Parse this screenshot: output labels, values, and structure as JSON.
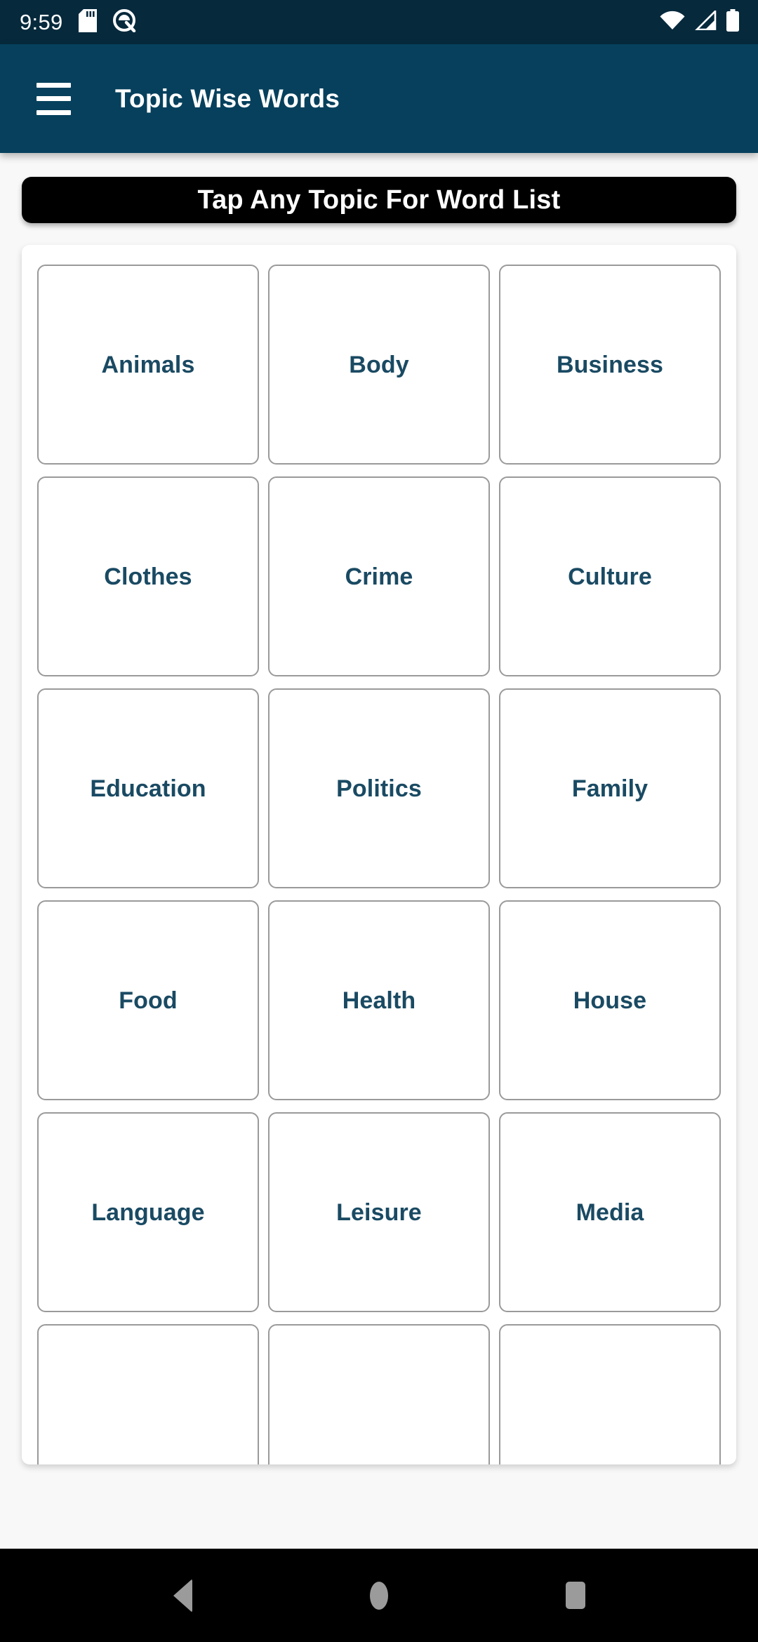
{
  "status_bar": {
    "clock": "9:59",
    "icons_left": [
      "sd-card-icon",
      "android-q-icon"
    ],
    "icons_right": [
      "wifi-icon",
      "cellular-signal-icon",
      "battery-icon"
    ],
    "background_color": "#06293c"
  },
  "app_bar": {
    "menu_icon": "hamburger-menu-icon",
    "title": "Topic Wise Words",
    "background_color": "#06405c",
    "text_color": "#ffffff"
  },
  "banner": {
    "text": "Tap Any Topic For Word List",
    "background_color": "#000000",
    "text_color": "#ffffff"
  },
  "topic_grid": {
    "columns": 3,
    "accent_text_color": "#1a4a63",
    "border_color": "#9a9a9a",
    "topics": [
      {
        "label": "Animals"
      },
      {
        "label": "Body"
      },
      {
        "label": "Business"
      },
      {
        "label": "Clothes"
      },
      {
        "label": "Crime"
      },
      {
        "label": "Culture"
      },
      {
        "label": "Education"
      },
      {
        "label": "Politics"
      },
      {
        "label": "Family"
      },
      {
        "label": "Food"
      },
      {
        "label": "Health"
      },
      {
        "label": "House"
      },
      {
        "label": "Language"
      },
      {
        "label": "Leisure"
      },
      {
        "label": "Media"
      },
      {
        "label": ""
      },
      {
        "label": ""
      },
      {
        "label": ""
      }
    ]
  },
  "nav_bar": {
    "background_color": "#000000",
    "icon_color": "#9b9b9b",
    "buttons": [
      {
        "name": "back-button",
        "icon": "back-triangle-icon"
      },
      {
        "name": "home-button",
        "icon": "home-circle-icon"
      },
      {
        "name": "recents-button",
        "icon": "recents-square-icon"
      }
    ]
  }
}
